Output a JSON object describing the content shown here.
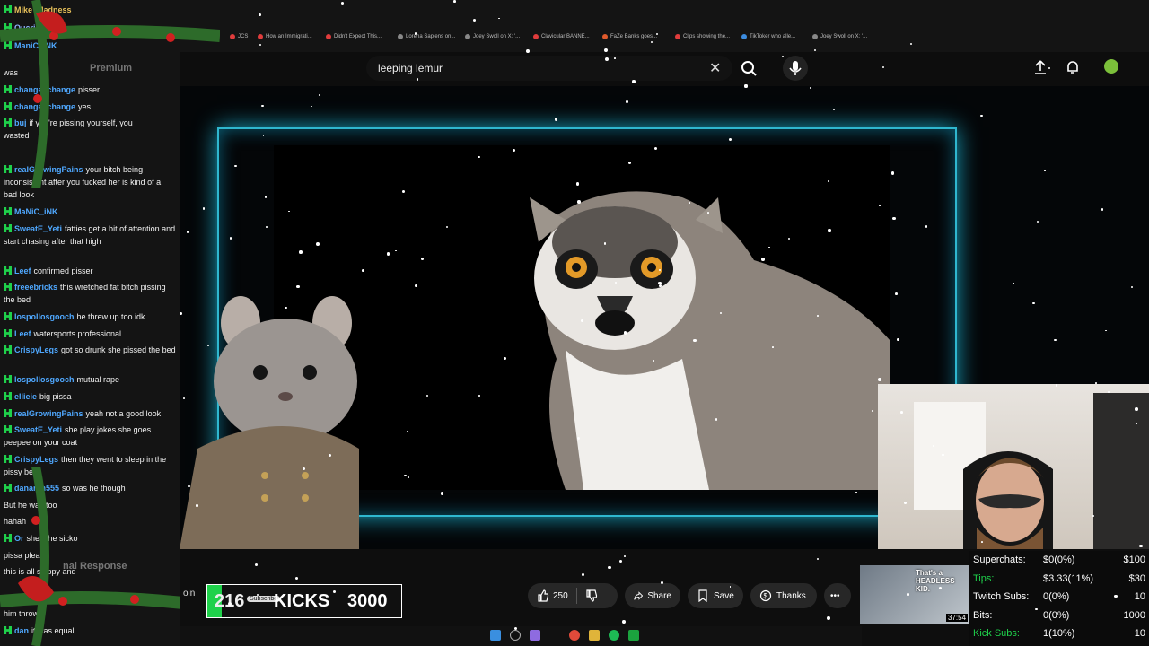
{
  "browser": {
    "tabs": [
      {
        "label": "JCS",
        "color": "#e03c3c"
      },
      {
        "label": "How an Immigrati...",
        "color": "#e03c3c"
      },
      {
        "label": "Didn't Expect This...",
        "color": "#e03c3c"
      },
      {
        "label": "Lorena Sapiens on...",
        "color": "#888888"
      },
      {
        "label": "Joey Swoll on X: '...",
        "color": "#888888"
      },
      {
        "label": "Clavicular BANNE...",
        "color": "#e03c3c"
      },
      {
        "label": "FaZe Banks goes...",
        "color": "#e05a2c"
      },
      {
        "label": "Clips showing the...",
        "color": "#e03c3c"
      },
      {
        "label": "TikToker who alle...",
        "color": "#3c8ce0"
      },
      {
        "label": "Joey Swoll on X: '...",
        "color": "#888888"
      }
    ]
  },
  "search": {
    "query": "leeping lemur"
  },
  "chat": {
    "messages": [
      {
        "user": "Mike_Madness",
        "text": "",
        "color": "#e8c15a"
      },
      {
        "user": "Qucria",
        "text": "",
        "color": "#8fb5ff"
      },
      {
        "user": "ManiC_iNK",
        "text": "",
        "color": "#4fa8ff"
      },
      {
        "user": "",
        "text": "was",
        "color": "#ffffff"
      },
      {
        "user": "changexchange",
        "text": "pisser",
        "color": "#4fa8ff"
      },
      {
        "user": "changexchange",
        "text": "yes",
        "color": "#4fa8ff"
      },
      {
        "user": "buj",
        "text": "if you're pissing yourself, you",
        "color": "#4fa8ff"
      },
      {
        "user": "",
        "text": "wasted",
        "color": "#ffffff"
      },
      {
        "user": "realGrowingPains",
        "text": "your bitch being inconsistent after you fucked her is kind of a bad look",
        "color": "#4fa8ff"
      },
      {
        "user": "MaNiC_iNK",
        "text": "",
        "color": "#4fa8ff"
      },
      {
        "user": "SweatE_Yeti",
        "text": "fatties get a bit of attention and start chasing after that high",
        "color": "#4fa8ff"
      },
      {
        "user": "Leef",
        "text": "confirmed pisser",
        "color": "#4fa8ff"
      },
      {
        "user": "freeebricks",
        "text": "this wretched fat bitch pissing the bed",
        "color": "#4fa8ff"
      },
      {
        "user": "lospollosgooch",
        "text": "he threw up too idk",
        "color": "#4fa8ff"
      },
      {
        "user": "Leef",
        "text": "watersports professional",
        "color": "#4fa8ff"
      },
      {
        "user": "CrispyLegs",
        "text": "got so drunk she pissed the bed",
        "color": "#4fa8ff"
      },
      {
        "user": "lospollosgooch",
        "text": "mutual rape",
        "color": "#4fa8ff"
      },
      {
        "user": "ellieie",
        "text": "big pissa",
        "color": "#4fa8ff"
      },
      {
        "user": "realGrowingPains",
        "text": "yeah not a good look",
        "color": "#4fa8ff"
      },
      {
        "user": "SweatE_Yeti",
        "text": "she play jokes she goes peepee on your coat",
        "color": "#4fa8ff"
      },
      {
        "user": "CrispyLegs",
        "text": "then they went to sleep in the pissy bed",
        "color": "#4fa8ff"
      },
      {
        "user": "danarah555",
        "text": "so was he though",
        "color": "#4fa8ff"
      },
      {
        "user": "",
        "text": "But he was too",
        "color": "#ffffff"
      },
      {
        "user": "",
        "text": "hahah",
        "color": "#ffffff"
      },
      {
        "user": "Or",
        "text": "shes the sicko",
        "color": "#4fa8ff"
      },
      {
        "user": "",
        "text": "pissa please",
        "color": "#ffffff"
      },
      {
        "user": "",
        "text": "this is all sloppy and",
        "color": "#ffffff"
      },
      {
        "user": "",
        "text": "him throw",
        "color": "#ffffff"
      },
      {
        "user": "dan",
        "text": "it was equal",
        "color": "#4fa8ff"
      }
    ]
  },
  "actions": {
    "likes": "250",
    "share": "Share",
    "save": "Save",
    "thanks": "Thanks",
    "more": "•••"
  },
  "kicks": {
    "count": "216",
    "label": "KICKS",
    "goal": "3000",
    "subscribe": "Subscribe",
    "progress_fraction": 0.072
  },
  "thumbnail": {
    "caption": "That's a HEADLESS KID.",
    "time": "37:54"
  },
  "stats": [
    {
      "label": "Superchats:",
      "value": "$0(0%)",
      "goal": "$100",
      "label_color": "#ffffff"
    },
    {
      "label": "Tips:",
      "value": "$3.33(11%)",
      "goal": "$30",
      "label_color": "#1fd14b"
    },
    {
      "label": "Twitch Subs:",
      "value": "0(0%)",
      "goal": "10",
      "label_color": "#ffffff"
    },
    {
      "label": "Bits:",
      "value": "0(0%)",
      "goal": "1000",
      "label_color": "#ffffff"
    },
    {
      "label": "Kick Subs:",
      "value": "1(10%)",
      "goal": "10",
      "label_color": "#1fd14b"
    }
  ],
  "side_labels": {
    "premium": "Premium",
    "response": "nal Response",
    "join": "oin"
  },
  "colors": {
    "accent": "#1fd14b",
    "frame": "#2fb7cf"
  }
}
